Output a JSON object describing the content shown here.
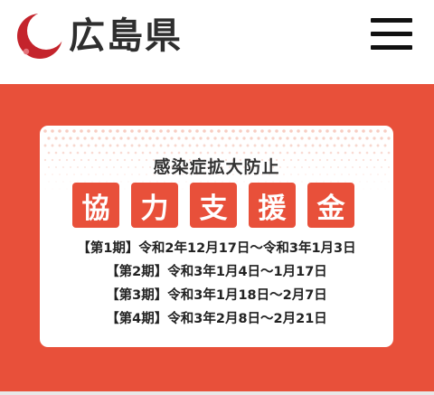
{
  "header": {
    "logo_text": "広島県",
    "brand_color": "#c4242c",
    "menu_icon": "hamburger-menu-icon"
  },
  "banner": {
    "background_color": "#e8503a",
    "subtitle": "感染症拡大防止",
    "title_chars": [
      "協",
      "力",
      "支",
      "援",
      "金"
    ],
    "periods": [
      "【第1期】令和2年12月17日～令和3年1月3日",
      "【第2期】令和3年1月4日～1月17日",
      "【第3期】令和3年1月18日～2月7日",
      "【第4期】令和3年2月8日～2月21日"
    ]
  }
}
